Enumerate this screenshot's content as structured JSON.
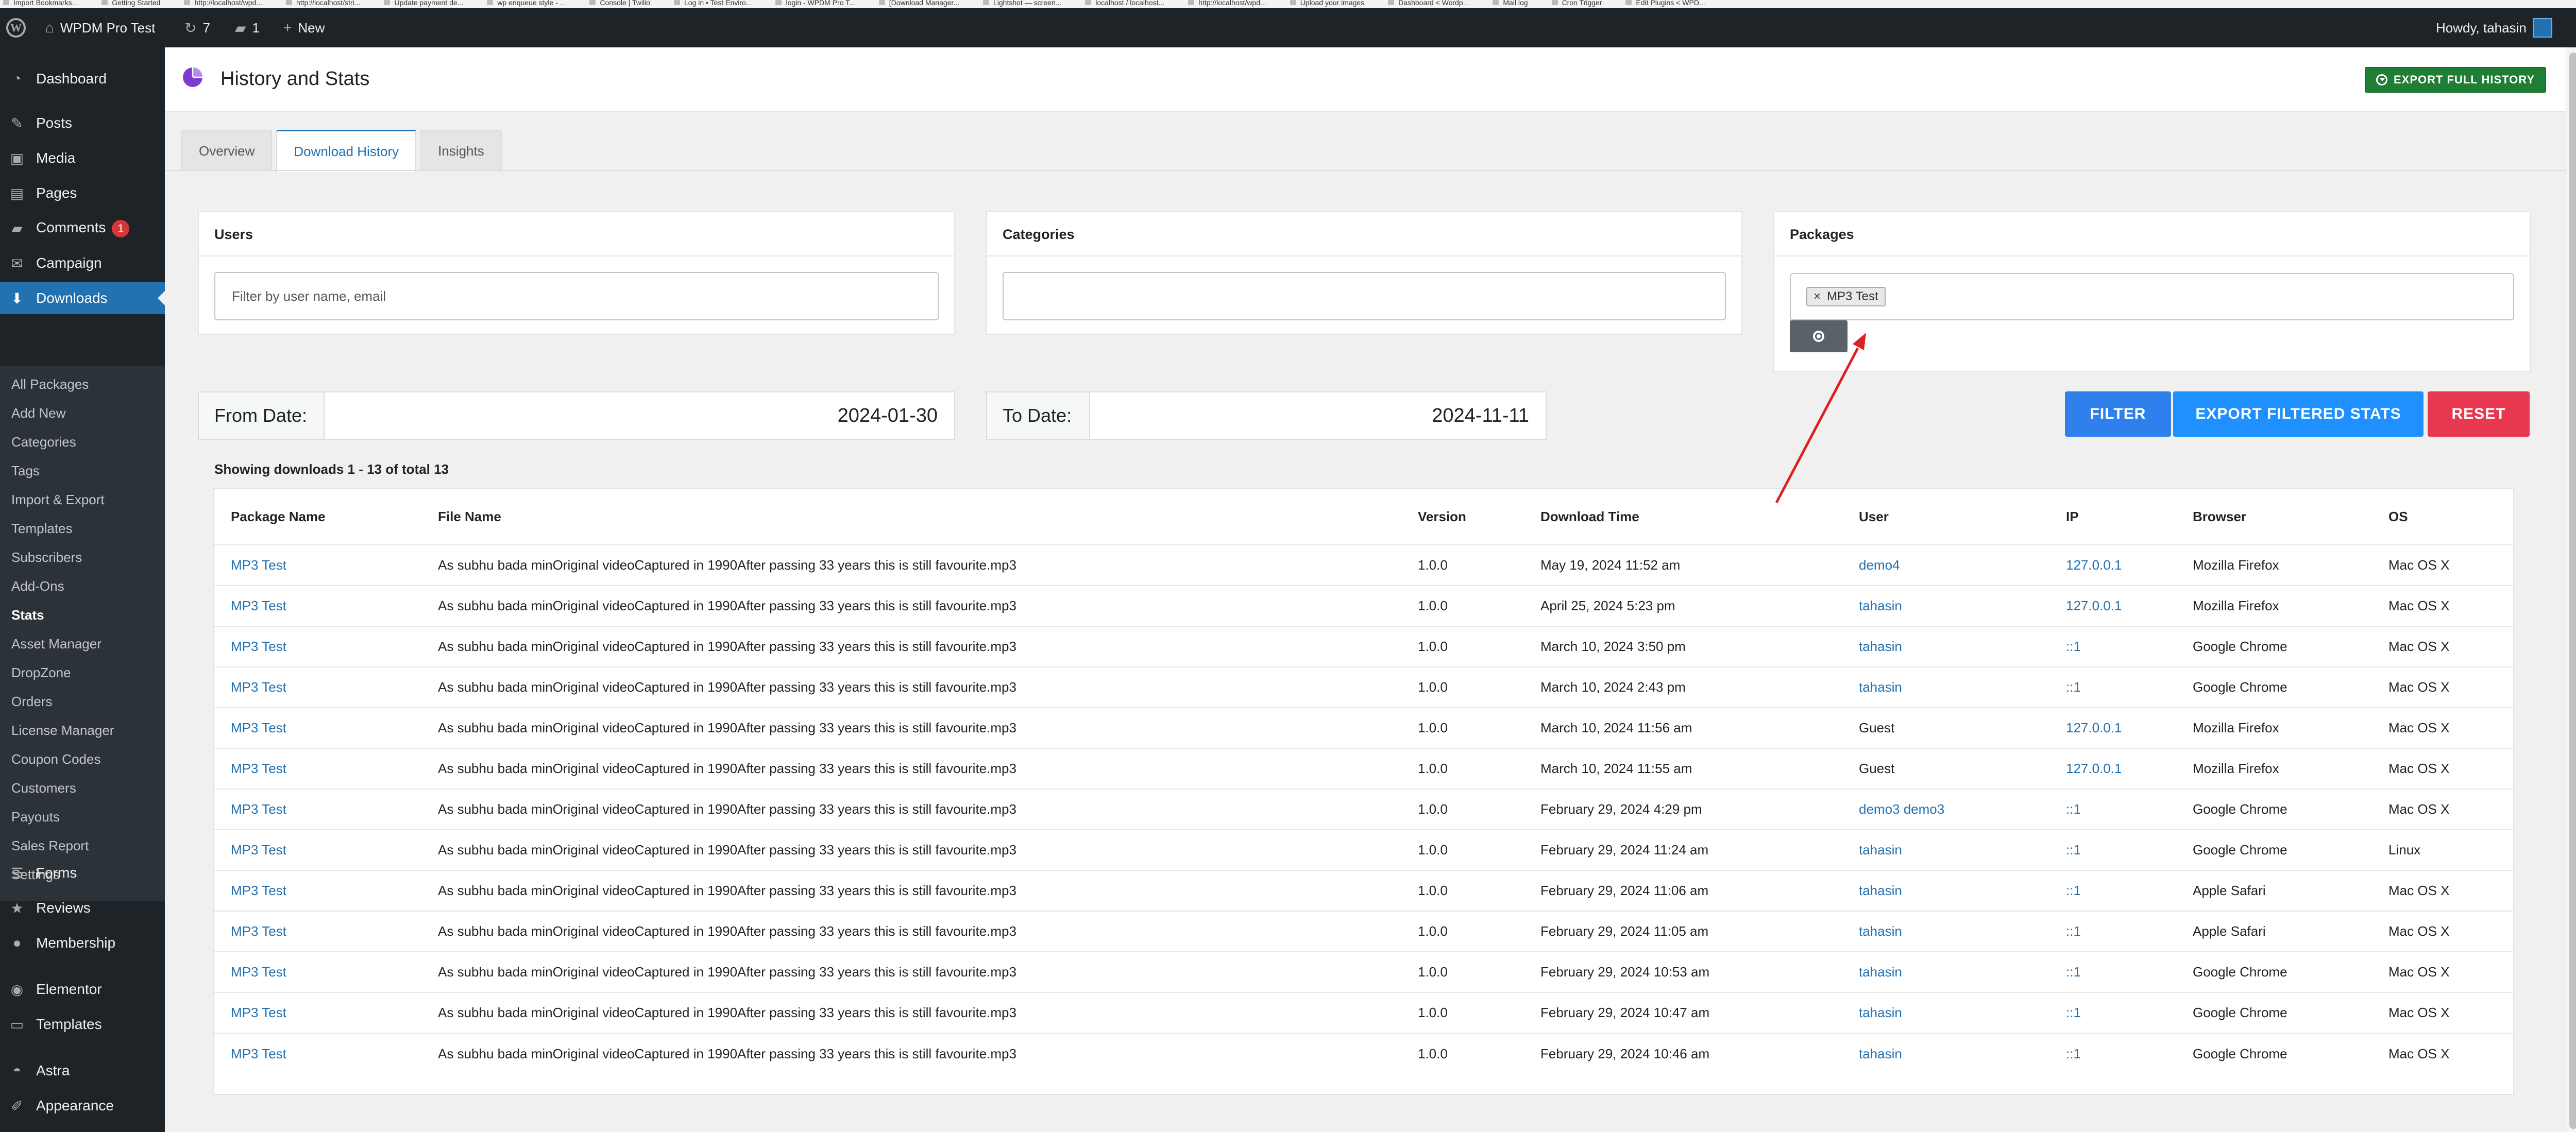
{
  "bookmarks": [
    "Import Bookmarks...",
    "Getting Started",
    "http://localhost/wpd...",
    "http://localhost/stri...",
    "Update payment de...",
    "wp enqueue style - ...",
    "Console | Twilio",
    "Log in • Test Enviro...",
    "login - WPDM Pro T...",
    "[Download Manager...",
    "Lightshot — screen...",
    "localhost / localhost...",
    "http://localhost/wpd...",
    "Upload your images",
    "Dashboard < Wordp...",
    "Mail log",
    "Cron Trigger",
    "Edit Plugins < WPD..."
  ],
  "adminbar": {
    "wp_logo": "W",
    "site_name": "WPDM Pro Test",
    "updates_count": "7",
    "comments_count": "1",
    "new_label": "New",
    "howdy": "Howdy, tahasin"
  },
  "sidebar": {
    "dashboard": "Dashboard",
    "posts": "Posts",
    "media": "Media",
    "pages": "Pages",
    "comments": "Comments",
    "comments_badge": "1",
    "campaign": "Campaign",
    "downloads": "Downloads",
    "submenu": [
      "All Packages",
      "Add New",
      "Categories",
      "Tags",
      "Import & Export",
      "Templates",
      "Subscribers",
      "Add-Ons",
      "Stats",
      "Asset Manager",
      "DropZone",
      "Orders",
      "License Manager",
      "Coupon Codes",
      "Customers",
      "Payouts",
      "Sales Report",
      "Settings"
    ],
    "forms": "Forms",
    "reviews": "Reviews",
    "membership": "Membership",
    "elementor": "Elementor",
    "templates": "Templates",
    "astra": "Astra",
    "appearance": "Appearance"
  },
  "header": {
    "title": "History and Stats",
    "export_full": "EXPORT FULL HISTORY"
  },
  "tabs": [
    "Overview",
    "Download History",
    "Insights"
  ],
  "filters": {
    "users_title": "Users",
    "users_placeholder": "Filter by user name, email",
    "categories_title": "Categories",
    "packages_title": "Packages",
    "package_chip": "MP3 Test",
    "chip_remove": "×"
  },
  "dates": {
    "from_label": "From Date:",
    "from_value": "2024-01-30",
    "to_label": "To Date:",
    "to_value": "2024-11-11"
  },
  "buttons": {
    "filter": "FILTER",
    "export_filtered": "EXPORT FILTERED STATS",
    "reset": "RESET"
  },
  "showing": "Showing downloads 1 - 13 of total 13",
  "table": {
    "columns": [
      "Package Name",
      "File Name",
      "Version",
      "Download Time",
      "User",
      "IP",
      "Browser",
      "OS"
    ],
    "rows": [
      [
        "MP3 Test",
        "As subhu bada minOriginal videoCaptured in 1990After passing 33 years this is still favourite.mp3",
        "1.0.0",
        "May 19, 2024 11:52 am",
        "demo4",
        "127.0.0.1",
        "Mozilla Firefox",
        "Mac OS X"
      ],
      [
        "MP3 Test",
        "As subhu bada minOriginal videoCaptured in 1990After passing 33 years this is still favourite.mp3",
        "1.0.0",
        "April 25, 2024 5:23 pm",
        "tahasin",
        "127.0.0.1",
        "Mozilla Firefox",
        "Mac OS X"
      ],
      [
        "MP3 Test",
        "As subhu bada minOriginal videoCaptured in 1990After passing 33 years this is still favourite.mp3",
        "1.0.0",
        "March 10, 2024 3:50 pm",
        "tahasin",
        "::1",
        "Google Chrome",
        "Mac OS X"
      ],
      [
        "MP3 Test",
        "As subhu bada minOriginal videoCaptured in 1990After passing 33 years this is still favourite.mp3",
        "1.0.0",
        "March 10, 2024 2:43 pm",
        "tahasin",
        "::1",
        "Google Chrome",
        "Mac OS X"
      ],
      [
        "MP3 Test",
        "As subhu bada minOriginal videoCaptured in 1990After passing 33 years this is still favourite.mp3",
        "1.0.0",
        "March 10, 2024 11:56 am",
        "Guest",
        "127.0.0.1",
        "Mozilla Firefox",
        "Mac OS X"
      ],
      [
        "MP3 Test",
        "As subhu bada minOriginal videoCaptured in 1990After passing 33 years this is still favourite.mp3",
        "1.0.0",
        "March 10, 2024 11:55 am",
        "Guest",
        "127.0.0.1",
        "Mozilla Firefox",
        "Mac OS X"
      ],
      [
        "MP3 Test",
        "As subhu bada minOriginal videoCaptured in 1990After passing 33 years this is still favourite.mp3",
        "1.0.0",
        "February 29, 2024 4:29 pm",
        "demo3 demo3",
        "::1",
        "Google Chrome",
        "Mac OS X"
      ],
      [
        "MP3 Test",
        "As subhu bada minOriginal videoCaptured in 1990After passing 33 years this is still favourite.mp3",
        "1.0.0",
        "February 29, 2024 11:24 am",
        "tahasin",
        "::1",
        "Google Chrome",
        "Linux"
      ],
      [
        "MP3 Test",
        "As subhu bada minOriginal videoCaptured in 1990After passing 33 years this is still favourite.mp3",
        "1.0.0",
        "February 29, 2024 11:06 am",
        "tahasin",
        "::1",
        "Apple Safari",
        "Mac OS X"
      ],
      [
        "MP3 Test",
        "As subhu bada minOriginal videoCaptured in 1990After passing 33 years this is still favourite.mp3",
        "1.0.0",
        "February 29, 2024 11:05 am",
        "tahasin",
        "::1",
        "Apple Safari",
        "Mac OS X"
      ],
      [
        "MP3 Test",
        "As subhu bada minOriginal videoCaptured in 1990After passing 33 years this is still favourite.mp3",
        "1.0.0",
        "February 29, 2024 10:53 am",
        "tahasin",
        "::1",
        "Google Chrome",
        "Mac OS X"
      ],
      [
        "MP3 Test",
        "As subhu bada minOriginal videoCaptured in 1990After passing 33 years this is still favourite.mp3",
        "1.0.0",
        "February 29, 2024 10:47 am",
        "tahasin",
        "::1",
        "Google Chrome",
        "Mac OS X"
      ],
      [
        "MP3 Test",
        "As subhu bada minOriginal videoCaptured in 1990After passing 33 years this is still favourite.mp3",
        "1.0.0",
        "February 29, 2024 10:46 am",
        "tahasin",
        "::1",
        "Google Chrome",
        "Mac OS X"
      ]
    ]
  },
  "colors": {
    "admin_dark": "#1d2327",
    "wp_blue": "#2271b1",
    "export_green": "#1e7e34",
    "filter_blue": "#2f80ed",
    "export_filtered_blue": "#1e90ff",
    "reset_red": "#e8384f",
    "annotation_red": "#e02020",
    "title_icon_purple": "#7e3bd0"
  }
}
